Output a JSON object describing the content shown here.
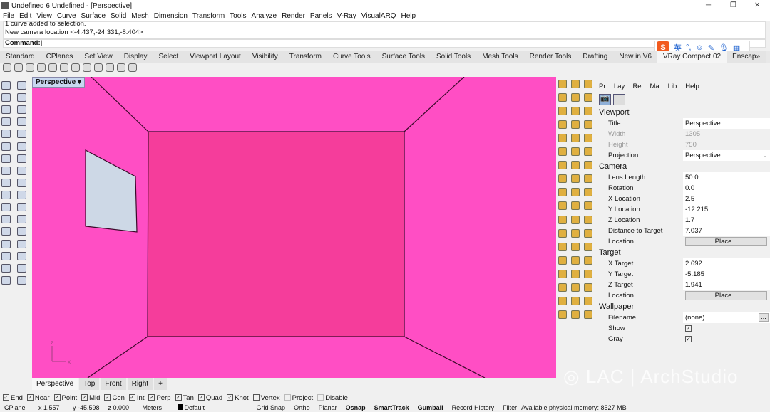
{
  "window": {
    "title": "Undefined 6 Undefined - [Perspective]"
  },
  "menu": [
    "File",
    "Edit",
    "View",
    "Curve",
    "Surface",
    "Solid",
    "Mesh",
    "Dimension",
    "Transform",
    "Tools",
    "Analyze",
    "Render",
    "Panels",
    "V-Ray",
    "VisualARQ",
    "Help"
  ],
  "history": [
    "1 curve added to selection.",
    "New camera location <-4.437,-24.331,-8.404>"
  ],
  "command": {
    "label": "Command:"
  },
  "toolbar_tabs": [
    "Standard",
    "CPlanes",
    "Set View",
    "Display",
    "Select",
    "Viewport Layout",
    "Visibility",
    "Transform",
    "Curve Tools",
    "Surface Tools",
    "Solid Tools",
    "Mesh Tools",
    "Render Tools",
    "Drafting",
    "New in V6",
    "VRay Compact 02",
    "Enscap»"
  ],
  "ime": {
    "logo": "S",
    "lang": "英",
    "punct": "°,"
  },
  "viewport": {
    "label": "Perspective",
    "colors": {
      "background": "#ff4ec4",
      "back_wall": "#f53d9b",
      "window": "#cdd8e6",
      "edges": "#3a0a2a"
    },
    "axes": {
      "z": "z",
      "x": "x"
    }
  },
  "viewport_tabs": [
    "Perspective",
    "Top",
    "Front",
    "Right",
    "+"
  ],
  "panel": {
    "tabs": [
      "Pr...",
      "Lay...",
      "Re...",
      "Ma...",
      "Lib...",
      "Help"
    ],
    "sections": {
      "viewport": {
        "title": "Viewport",
        "rows": [
          {
            "label": "Title",
            "value": "Perspective"
          },
          {
            "label": "Width",
            "value": "1305"
          },
          {
            "label": "Height",
            "value": "750"
          },
          {
            "label": "Projection",
            "value": "Perspective"
          }
        ]
      },
      "camera": {
        "title": "Camera",
        "rows": [
          {
            "label": "Lens Length",
            "value": "50.0"
          },
          {
            "label": "Rotation",
            "value": "0.0"
          },
          {
            "label": "X Location",
            "value": "2.5"
          },
          {
            "label": "Y Location",
            "value": "-12.215"
          },
          {
            "label": "Z Location",
            "value": "1.7"
          },
          {
            "label": "Distance to Target",
            "value": "7.037"
          },
          {
            "label": "Location",
            "value": "Place..."
          }
        ]
      },
      "target": {
        "title": "Target",
        "rows": [
          {
            "label": "X Target",
            "value": "2.692"
          },
          {
            "label": "Y Target",
            "value": "-5.185"
          },
          {
            "label": "Z Target",
            "value": "1.941"
          },
          {
            "label": "Location",
            "value": "Place..."
          }
        ]
      },
      "wallpaper": {
        "title": "Wallpaper",
        "rows": [
          {
            "label": "Filename",
            "value": "(none)"
          },
          {
            "label": "Show",
            "value": "✓"
          },
          {
            "label": "Gray",
            "value": "✓"
          }
        ],
        "browse": "..."
      }
    }
  },
  "osnap": [
    {
      "label": "End",
      "checked": true
    },
    {
      "label": "Near",
      "checked": true
    },
    {
      "label": "Point",
      "checked": true
    },
    {
      "label": "Mid",
      "checked": true
    },
    {
      "label": "Cen",
      "checked": true
    },
    {
      "label": "Int",
      "checked": true
    },
    {
      "label": "Perp",
      "checked": true
    },
    {
      "label": "Tan",
      "checked": true
    },
    {
      "label": "Quad",
      "checked": true
    },
    {
      "label": "Knot",
      "checked": true
    },
    {
      "label": "Vertex",
      "checked": false
    },
    {
      "label": "Project",
      "checked": false
    },
    {
      "label": "Disable",
      "checked": false
    }
  ],
  "status": {
    "cplane": "CPlane",
    "x": "x 1.557",
    "y": "y -45.598",
    "z": "z 0.000",
    "units": "Meters",
    "layer": "Default",
    "toggles": [
      "Grid Snap",
      "Ortho",
      "Planar",
      "Osnap",
      "SmartTrack",
      "Gumball",
      "Record History",
      "Filter"
    ],
    "memory": "Available physical memory: 8527 MB"
  },
  "watermark": "LAC | ArchStudio"
}
